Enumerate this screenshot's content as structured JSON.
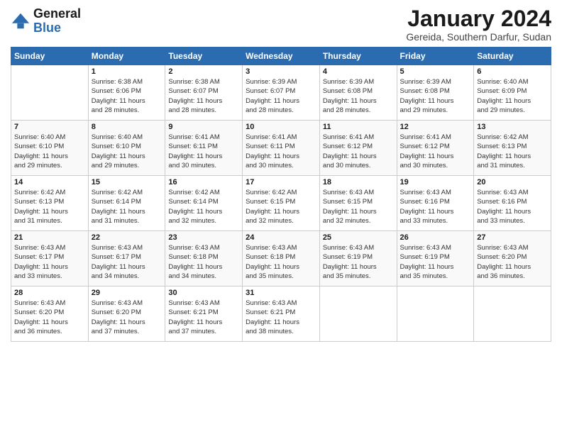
{
  "logo": {
    "general": "General",
    "blue": "Blue"
  },
  "title": "January 2024",
  "subtitle": "Gereida, Southern Darfur, Sudan",
  "days": [
    "Sunday",
    "Monday",
    "Tuesday",
    "Wednesday",
    "Thursday",
    "Friday",
    "Saturday"
  ],
  "weeks": [
    [
      {
        "day": "",
        "content": ""
      },
      {
        "day": "1",
        "content": "Sunrise: 6:38 AM\nSunset: 6:06 PM\nDaylight: 11 hours\nand 28 minutes."
      },
      {
        "day": "2",
        "content": "Sunrise: 6:38 AM\nSunset: 6:07 PM\nDaylight: 11 hours\nand 28 minutes."
      },
      {
        "day": "3",
        "content": "Sunrise: 6:39 AM\nSunset: 6:07 PM\nDaylight: 11 hours\nand 28 minutes."
      },
      {
        "day": "4",
        "content": "Sunrise: 6:39 AM\nSunset: 6:08 PM\nDaylight: 11 hours\nand 28 minutes."
      },
      {
        "day": "5",
        "content": "Sunrise: 6:39 AM\nSunset: 6:08 PM\nDaylight: 11 hours\nand 29 minutes."
      },
      {
        "day": "6",
        "content": "Sunrise: 6:40 AM\nSunset: 6:09 PM\nDaylight: 11 hours\nand 29 minutes."
      }
    ],
    [
      {
        "day": "7",
        "content": "Sunrise: 6:40 AM\nSunset: 6:10 PM\nDaylight: 11 hours\nand 29 minutes."
      },
      {
        "day": "8",
        "content": "Sunrise: 6:40 AM\nSunset: 6:10 PM\nDaylight: 11 hours\nand 29 minutes."
      },
      {
        "day": "9",
        "content": "Sunrise: 6:41 AM\nSunset: 6:11 PM\nDaylight: 11 hours\nand 30 minutes."
      },
      {
        "day": "10",
        "content": "Sunrise: 6:41 AM\nSunset: 6:11 PM\nDaylight: 11 hours\nand 30 minutes."
      },
      {
        "day": "11",
        "content": "Sunrise: 6:41 AM\nSunset: 6:12 PM\nDaylight: 11 hours\nand 30 minutes."
      },
      {
        "day": "12",
        "content": "Sunrise: 6:41 AM\nSunset: 6:12 PM\nDaylight: 11 hours\nand 30 minutes."
      },
      {
        "day": "13",
        "content": "Sunrise: 6:42 AM\nSunset: 6:13 PM\nDaylight: 11 hours\nand 31 minutes."
      }
    ],
    [
      {
        "day": "14",
        "content": "Sunrise: 6:42 AM\nSunset: 6:13 PM\nDaylight: 11 hours\nand 31 minutes."
      },
      {
        "day": "15",
        "content": "Sunrise: 6:42 AM\nSunset: 6:14 PM\nDaylight: 11 hours\nand 31 minutes."
      },
      {
        "day": "16",
        "content": "Sunrise: 6:42 AM\nSunset: 6:14 PM\nDaylight: 11 hours\nand 32 minutes."
      },
      {
        "day": "17",
        "content": "Sunrise: 6:42 AM\nSunset: 6:15 PM\nDaylight: 11 hours\nand 32 minutes."
      },
      {
        "day": "18",
        "content": "Sunrise: 6:43 AM\nSunset: 6:15 PM\nDaylight: 11 hours\nand 32 minutes."
      },
      {
        "day": "19",
        "content": "Sunrise: 6:43 AM\nSunset: 6:16 PM\nDaylight: 11 hours\nand 33 minutes."
      },
      {
        "day": "20",
        "content": "Sunrise: 6:43 AM\nSunset: 6:16 PM\nDaylight: 11 hours\nand 33 minutes."
      }
    ],
    [
      {
        "day": "21",
        "content": "Sunrise: 6:43 AM\nSunset: 6:17 PM\nDaylight: 11 hours\nand 33 minutes."
      },
      {
        "day": "22",
        "content": "Sunrise: 6:43 AM\nSunset: 6:17 PM\nDaylight: 11 hours\nand 34 minutes."
      },
      {
        "day": "23",
        "content": "Sunrise: 6:43 AM\nSunset: 6:18 PM\nDaylight: 11 hours\nand 34 minutes."
      },
      {
        "day": "24",
        "content": "Sunrise: 6:43 AM\nSunset: 6:18 PM\nDaylight: 11 hours\nand 35 minutes."
      },
      {
        "day": "25",
        "content": "Sunrise: 6:43 AM\nSunset: 6:19 PM\nDaylight: 11 hours\nand 35 minutes."
      },
      {
        "day": "26",
        "content": "Sunrise: 6:43 AM\nSunset: 6:19 PM\nDaylight: 11 hours\nand 35 minutes."
      },
      {
        "day": "27",
        "content": "Sunrise: 6:43 AM\nSunset: 6:20 PM\nDaylight: 11 hours\nand 36 minutes."
      }
    ],
    [
      {
        "day": "28",
        "content": "Sunrise: 6:43 AM\nSunset: 6:20 PM\nDaylight: 11 hours\nand 36 minutes."
      },
      {
        "day": "29",
        "content": "Sunrise: 6:43 AM\nSunset: 6:20 PM\nDaylight: 11 hours\nand 37 minutes."
      },
      {
        "day": "30",
        "content": "Sunrise: 6:43 AM\nSunset: 6:21 PM\nDaylight: 11 hours\nand 37 minutes."
      },
      {
        "day": "31",
        "content": "Sunrise: 6:43 AM\nSunset: 6:21 PM\nDaylight: 11 hours\nand 38 minutes."
      },
      {
        "day": "",
        "content": ""
      },
      {
        "day": "",
        "content": ""
      },
      {
        "day": "",
        "content": ""
      }
    ]
  ]
}
